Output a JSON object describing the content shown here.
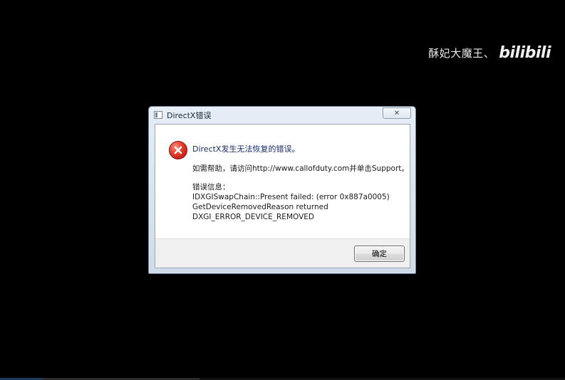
{
  "watermark": {
    "text": "酥妃大魔王、",
    "logo": "bilibili"
  },
  "dialog": {
    "title": "DirectX错误",
    "close_label": "✕",
    "main_message": "DirectX发生无法恢复的错误。",
    "help_message": "如需帮助，请访问http://www.callofduty.com并单击Support。",
    "error_info_label": "错误信息：",
    "error_lines": [
      "IDXGISwapChain::Present failed: (error 0x887a0005)",
      "GetDeviceRemovedReason returned",
      "DXGI_ERROR_DEVICE_REMOVED"
    ],
    "ok_label": "确定",
    "icon": "error-icon"
  },
  "colors": {
    "background": "#000000",
    "error_red": "#e23a2a",
    "title_text": "#1a2c6b"
  }
}
